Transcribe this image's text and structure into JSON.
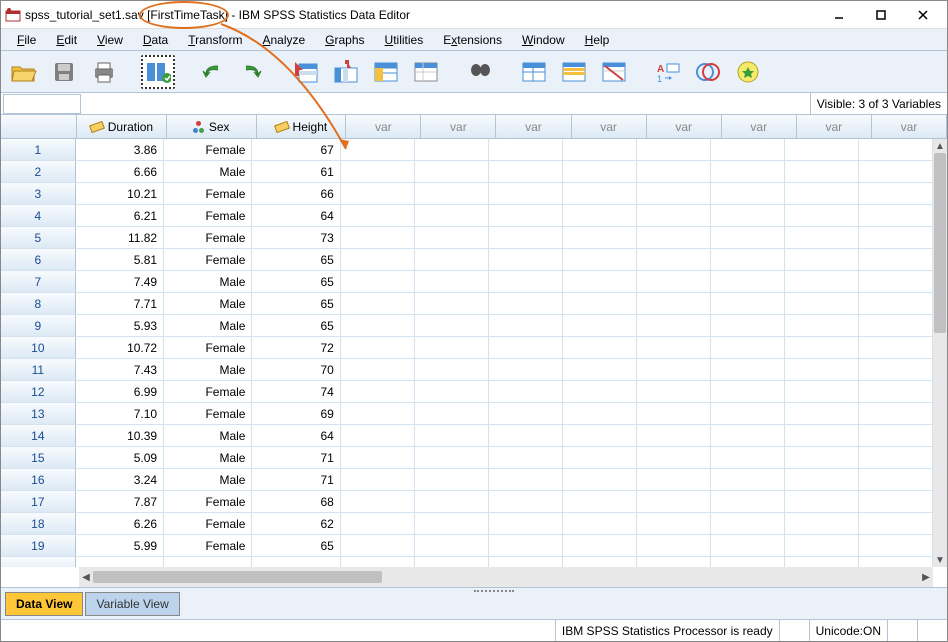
{
  "title": {
    "filename": "spss_tutorial_set1.sav",
    "dataset": "[FirstTimeTask]",
    "app": "- IBM SPSS Statistics Data Editor"
  },
  "menus": [
    "File",
    "Edit",
    "View",
    "Data",
    "Transform",
    "Analyze",
    "Graphs",
    "Utilities",
    "Extensions",
    "Window",
    "Help"
  ],
  "infobar": {
    "visible": "Visible: 3 of 3 Variables"
  },
  "columns": {
    "defined": [
      {
        "name": "Duration",
        "type": "scale"
      },
      {
        "name": "Sex",
        "type": "nominal"
      },
      {
        "name": "Height",
        "type": "scale"
      }
    ],
    "empty_label": "var",
    "empty_count": 8
  },
  "rows": [
    {
      "n": "1",
      "Duration": "3.86",
      "Sex": "Female",
      "Height": "67"
    },
    {
      "n": "2",
      "Duration": "6.66",
      "Sex": "Male",
      "Height": "61"
    },
    {
      "n": "3",
      "Duration": "10.21",
      "Sex": "Female",
      "Height": "66"
    },
    {
      "n": "4",
      "Duration": "6.21",
      "Sex": "Female",
      "Height": "64"
    },
    {
      "n": "5",
      "Duration": "11.82",
      "Sex": "Female",
      "Height": "73"
    },
    {
      "n": "6",
      "Duration": "5.81",
      "Sex": "Female",
      "Height": "65"
    },
    {
      "n": "7",
      "Duration": "7.49",
      "Sex": "Male",
      "Height": "65"
    },
    {
      "n": "8",
      "Duration": "7.71",
      "Sex": "Male",
      "Height": "65"
    },
    {
      "n": "9",
      "Duration": "5.93",
      "Sex": "Male",
      "Height": "65"
    },
    {
      "n": "10",
      "Duration": "10.72",
      "Sex": "Female",
      "Height": "72"
    },
    {
      "n": "11",
      "Duration": "7.43",
      "Sex": "Male",
      "Height": "70"
    },
    {
      "n": "12",
      "Duration": "6.99",
      "Sex": "Female",
      "Height": "74"
    },
    {
      "n": "13",
      "Duration": "7.10",
      "Sex": "Female",
      "Height": "69"
    },
    {
      "n": "14",
      "Duration": "10.39",
      "Sex": "Male",
      "Height": "64"
    },
    {
      "n": "15",
      "Duration": "5.09",
      "Sex": "Male",
      "Height": "71"
    },
    {
      "n": "16",
      "Duration": "3.24",
      "Sex": "Male",
      "Height": "71"
    },
    {
      "n": "17",
      "Duration": "7.87",
      "Sex": "Female",
      "Height": "68"
    },
    {
      "n": "18",
      "Duration": "6.26",
      "Sex": "Female",
      "Height": "62"
    },
    {
      "n": "19",
      "Duration": "5.99",
      "Sex": "Female",
      "Height": "65"
    }
  ],
  "tabs": {
    "data_view": "Data View",
    "variable_view": "Variable View"
  },
  "status": {
    "processor": "IBM SPSS Statistics Processor is ready",
    "unicode": "Unicode:ON"
  }
}
